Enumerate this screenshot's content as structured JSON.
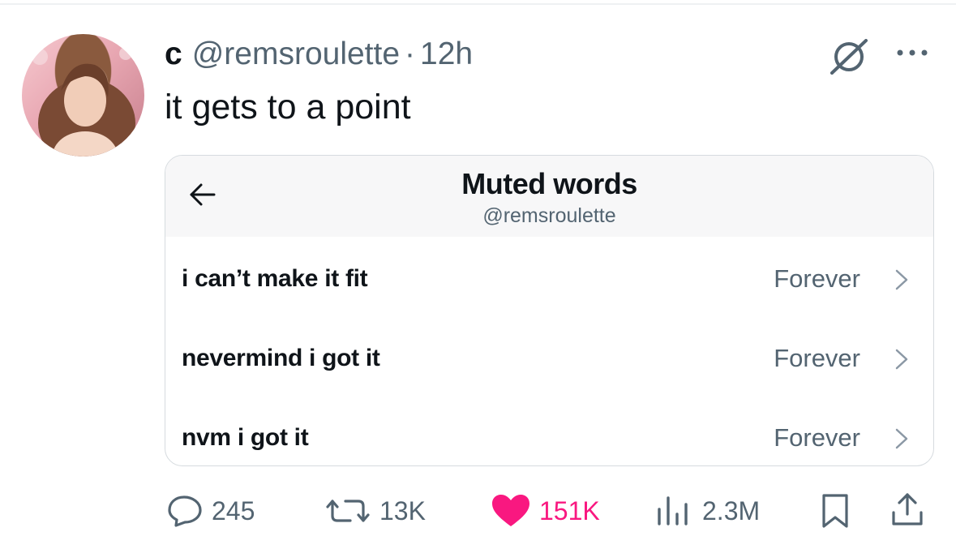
{
  "tweet": {
    "display_name": "c",
    "handle": "@remsroulette",
    "separator": "·",
    "time": "12h",
    "text": "it gets to a point"
  },
  "card": {
    "title": "Muted words",
    "subtitle": "@remsroulette",
    "rows": [
      {
        "word": "i can’t make it fit",
        "duration": "Forever"
      },
      {
        "word": "nevermind i got it",
        "duration": "Forever"
      },
      {
        "word": "nvm i got it",
        "duration": "Forever"
      }
    ]
  },
  "actions": {
    "replies": "245",
    "reposts": "13K",
    "likes": "151K",
    "views": "2.3M"
  },
  "colors": {
    "like_pink": "#f91880",
    "secondary_text": "#536471",
    "primary_text": "#0f1419"
  },
  "icons": [
    "grok-icon",
    "more-icon",
    "back-arrow-icon",
    "chevron-right-icon",
    "reply-icon",
    "repost-icon",
    "heart-icon",
    "views-icon",
    "bookmark-icon",
    "share-icon"
  ]
}
